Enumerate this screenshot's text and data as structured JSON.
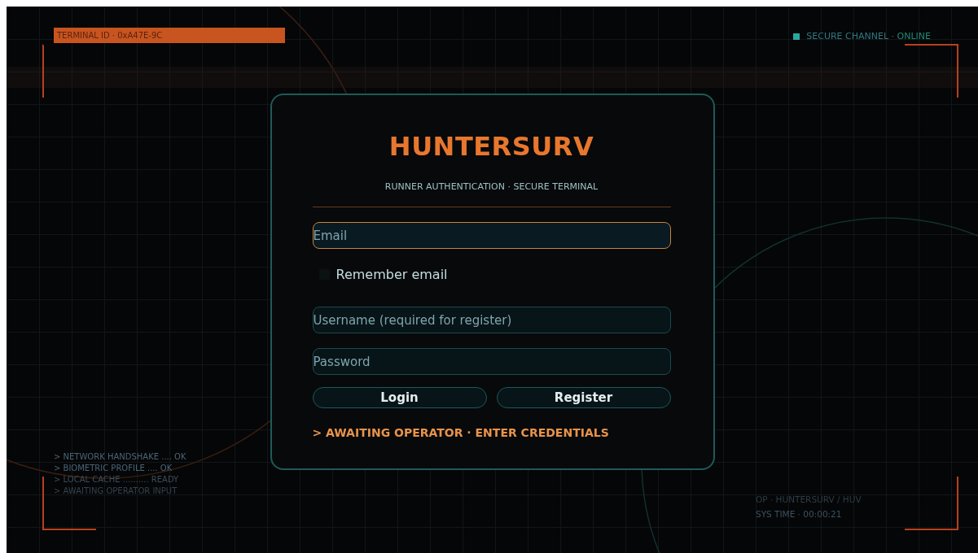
{
  "hud": {
    "terminal_id": "TERMINAL ID · 0xA47E-9C",
    "channel": {
      "label": "SECURE CHANNEL · ",
      "status": "ONLINE",
      "online": true
    },
    "status_lines": [
      {
        "text": "> NETWORK HANDSHAKE .... OK",
        "kind": "ok"
      },
      {
        "text": "> BIOMETRIC PROFILE .... OK",
        "kind": "ok"
      },
      {
        "text": "> LOCAL CACHE .......... READY",
        "kind": "ready"
      },
      {
        "text": "> AWAITING OPERATOR INPUT",
        "kind": "waiting"
      }
    ],
    "operator": "OP · HUNTERSURV / HUV",
    "sys_time": "SYS TIME · 00:00:21"
  },
  "login": {
    "title": "HUNTERSURV",
    "subtitle": "RUNNER AUTHENTICATION · SECURE TERMINAL",
    "fields": [
      {
        "kind": "text",
        "placeholder": "Email",
        "focused": true
      },
      {
        "kind": "checkbox",
        "label": "Remember email",
        "checked": false
      },
      {
        "kind": "text",
        "placeholder": "Username (required for register)",
        "focused": false
      },
      {
        "kind": "password",
        "placeholder": "Password",
        "focused": false
      }
    ],
    "buttons": [
      "Login",
      "Register"
    ],
    "message": "> AWAITING OPERATOR · ENTER CREDENTIALS"
  }
}
